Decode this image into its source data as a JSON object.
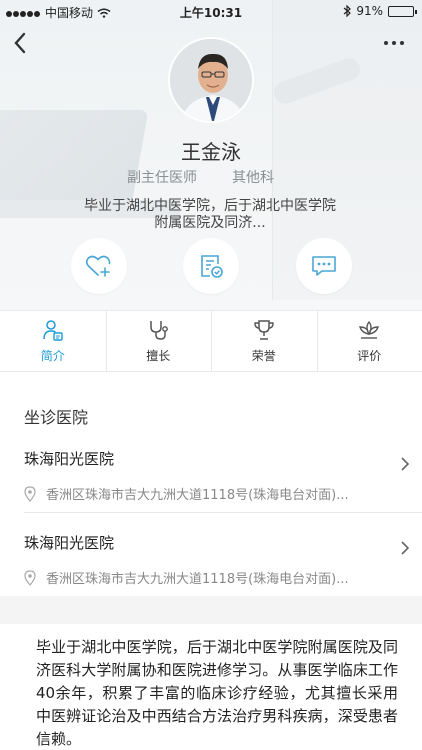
{
  "status_bar": {
    "carrier": "中国移动",
    "time": "上午10:31",
    "battery": "91%",
    "battery_level": 0.91
  },
  "doctor": {
    "name": "王金泳",
    "title": "副主任医师",
    "department": "其他科",
    "bio_lines": [
      "毕业于湖北中医学院，后于湖北中医学院",
      "附属医院及同济..."
    ]
  },
  "actions": [
    {
      "icon": "heart-plus-icon"
    },
    {
      "icon": "prescription-check-icon"
    },
    {
      "icon": "chat-bubble-icon"
    }
  ],
  "tabs": [
    {
      "label": "简介",
      "icon": "profile-card-icon",
      "active": true
    },
    {
      "label": "擅长",
      "icon": "stethoscope-icon",
      "active": false
    },
    {
      "label": "荣誉",
      "icon": "trophy-icon",
      "active": false
    },
    {
      "label": "评价",
      "icon": "lotus-icon",
      "active": false
    }
  ],
  "hospitals_section": {
    "title": "坐诊医院",
    "items": [
      {
        "name": "珠海阳光医院",
        "address": "香洲区珠海市吉大九洲大道1118号(珠海电台对面)..."
      },
      {
        "name": "珠海阳光医院",
        "address": "香洲区珠海市吉大九洲大道1118号(珠海电台对面)..."
      }
    ]
  },
  "introduction": "毕业于湖北中医学院，后于湖北中医学院附属医院及同济医科大学附属协和医院进修学习。从事医学临床工作40余年，积累了丰富的临床诊疗经验，尤其擅长采用中医辨证论治及中西结合方法治疗男科疾病，深受患者信赖。",
  "colors": {
    "accent": "#1f9bd8",
    "icon_line": "#4aa6d6"
  }
}
